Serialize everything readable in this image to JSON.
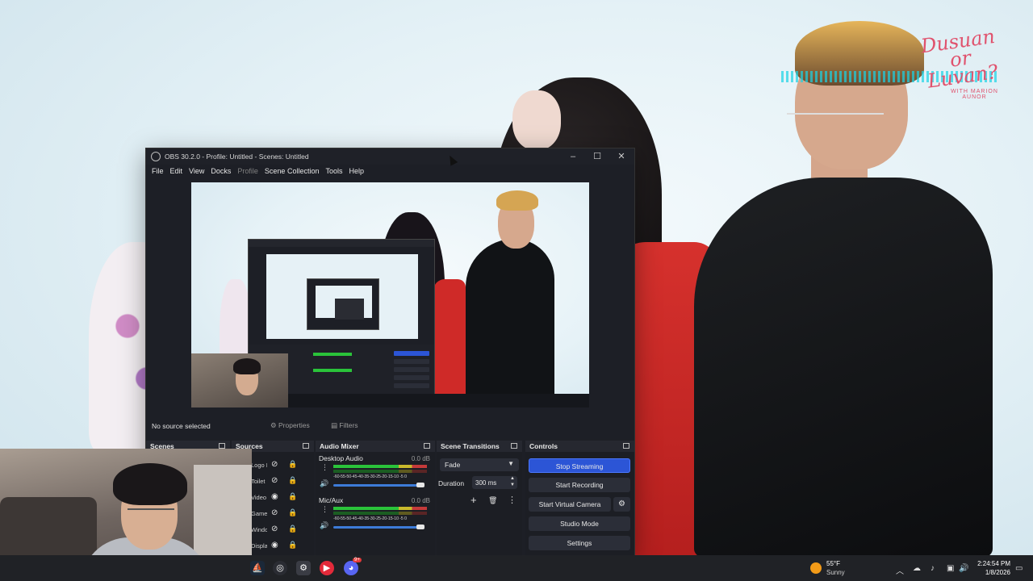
{
  "background": {
    "brand_title": "Dusuan or Luvan?",
    "brand_sub": "WITH MARION AUNOR"
  },
  "obs": {
    "window_title": "OBS 30.2.0 - Profile: Untitled - Scenes: Untitled",
    "menu": [
      "File",
      "Edit",
      "View",
      "Docks",
      "Profile",
      "Scene Collection",
      "Tools",
      "Help"
    ],
    "menu_disabled": "Profile",
    "source_status": "No source selected",
    "properties_label": "Properties",
    "filters_label": "Filters",
    "docks": {
      "scenes": "Scenes",
      "sources": "Sources",
      "audio_mixer": "Audio Mixer",
      "scene_transitions": "Scene Transitions",
      "controls": "Controls"
    },
    "sources": [
      {
        "label": "Logo I",
        "visible": false
      },
      {
        "label": "Toilet",
        "visible": false
      },
      {
        "label": "Video",
        "visible": true
      },
      {
        "label": "Game",
        "visible": false
      },
      {
        "label": "Windo",
        "visible": false
      },
      {
        "label": "Displa",
        "visible": true
      }
    ],
    "mixer": [
      {
        "name": "Desktop Audio",
        "db": "0.0 dB",
        "level": 0.85
      },
      {
        "name": "Mic/Aux",
        "db": "0.0 dB",
        "level": 0.85
      }
    ],
    "meter_ticks": "-60-55-50-45-40-35-30-25-20-15-10 -5  0",
    "transition": {
      "selected": "Fade",
      "duration_label": "Duration",
      "duration_value": "300 ms"
    },
    "controls": {
      "stop_streaming": "Stop Streaming",
      "start_recording": "Start Recording",
      "start_virtual_camera": "Start Virtual Camera",
      "studio_mode": "Studio Mode",
      "settings": "Settings"
    },
    "colors": {
      "accent": "#2c55d6",
      "bg": "#1d1f26"
    }
  },
  "taskbar": {
    "weather_temp": "55°F",
    "weather_desc": "Sunny",
    "time": "2:24:54 PM",
    "date": "1/8/2026",
    "discord_badge": "9+"
  }
}
